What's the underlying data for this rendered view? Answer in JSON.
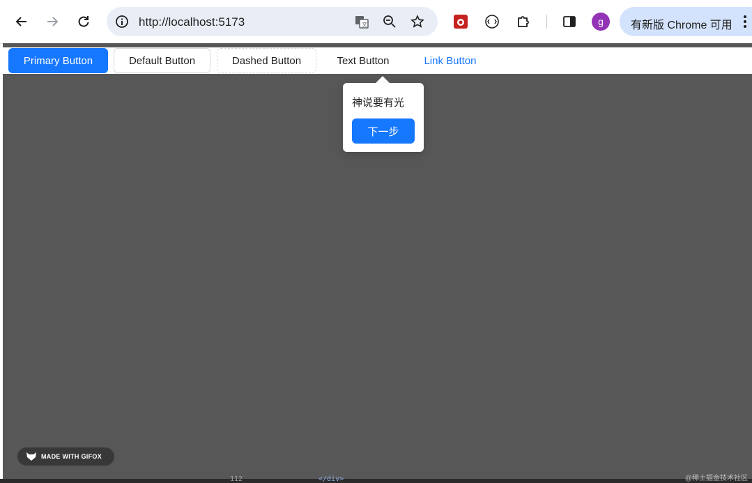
{
  "browser": {
    "url": "http://localhost:5173",
    "update_label": "有新版 Chrome 可用",
    "profile_initial": "g",
    "icons": {
      "back": "back-arrow-icon",
      "forward": "forward-arrow-icon",
      "reload": "reload-icon",
      "site_info": "info-icon",
      "translate": "translate-icon",
      "zoom": "zoom-icon",
      "bookmark": "star-icon",
      "extension_1": "extension-bug-icon",
      "extension_2": "extension-circle-icon",
      "extensions": "puzzle-icon",
      "side_panel": "side-panel-icon",
      "menu": "more-vert-icon"
    },
    "colors": {
      "omnibox": "#e9eef6",
      "update_pill": "#d3e3fd",
      "avatar": "#9334b6"
    }
  },
  "page": {
    "buttons": {
      "primary": "Primary Button",
      "default": "Default Button",
      "dashed": "Dashed Button",
      "text": "Text Button",
      "link": "Link Button"
    },
    "tour": {
      "title": "神说要有光",
      "next_label": "下一步"
    },
    "colors": {
      "primary": "#1677ff",
      "mask": "#575757"
    }
  },
  "overlay": {
    "gifox_label": "MADE WITH GIFOX",
    "code_line_number": "112",
    "code_text": "</div>",
    "corner_watermark": "@稀土掘金技术社区"
  }
}
